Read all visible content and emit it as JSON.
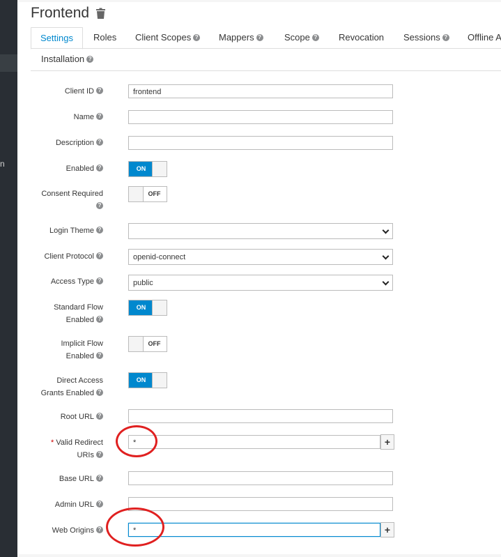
{
  "header": {
    "title": "Frontend",
    "delete_icon": "trash-icon"
  },
  "sidebar": {
    "fragment": "n"
  },
  "tabs": [
    {
      "label": "Settings",
      "help": false,
      "active": true
    },
    {
      "label": "Roles",
      "help": false
    },
    {
      "label": "Client Scopes",
      "help": true
    },
    {
      "label": "Mappers",
      "help": true
    },
    {
      "label": "Scope",
      "help": true
    },
    {
      "label": "Revocation",
      "help": false
    },
    {
      "label": "Sessions",
      "help": true
    },
    {
      "label": "Offline A",
      "help": false
    },
    {
      "label": "Installation",
      "help": true
    }
  ],
  "form": {
    "client_id": {
      "label": "Client ID",
      "value": "frontend"
    },
    "name": {
      "label": "Name",
      "value": ""
    },
    "description": {
      "label": "Description",
      "value": ""
    },
    "enabled": {
      "label": "Enabled",
      "state": "ON"
    },
    "consent_required": {
      "label": "Consent Required",
      "state": "OFF"
    },
    "login_theme": {
      "label": "Login Theme",
      "value": ""
    },
    "client_protocol": {
      "label": "Client Protocol",
      "value": "openid-connect"
    },
    "access_type": {
      "label": "Access Type",
      "value": "public"
    },
    "standard_flow": {
      "label_line1": "Standard Flow",
      "label_line2": "Enabled",
      "state": "ON"
    },
    "implicit_flow": {
      "label_line1": "Implicit Flow",
      "label_line2": "Enabled",
      "state": "OFF"
    },
    "direct_access": {
      "label_line1": "Direct Access",
      "label_line2": "Grants Enabled",
      "state": "ON"
    },
    "root_url": {
      "label": "Root URL",
      "value": ""
    },
    "valid_redirect": {
      "required_mark": "*",
      "label_line1": "Valid Redirect",
      "label_line2": "URIs",
      "value": "*"
    },
    "base_url": {
      "label": "Base URL",
      "value": ""
    },
    "admin_url": {
      "label": "Admin URL",
      "value": ""
    },
    "web_origins": {
      "label": "Web Origins",
      "value": "*"
    }
  },
  "icons": {
    "help": "?",
    "add": "+"
  },
  "annotations": {
    "color": "#e02020"
  }
}
